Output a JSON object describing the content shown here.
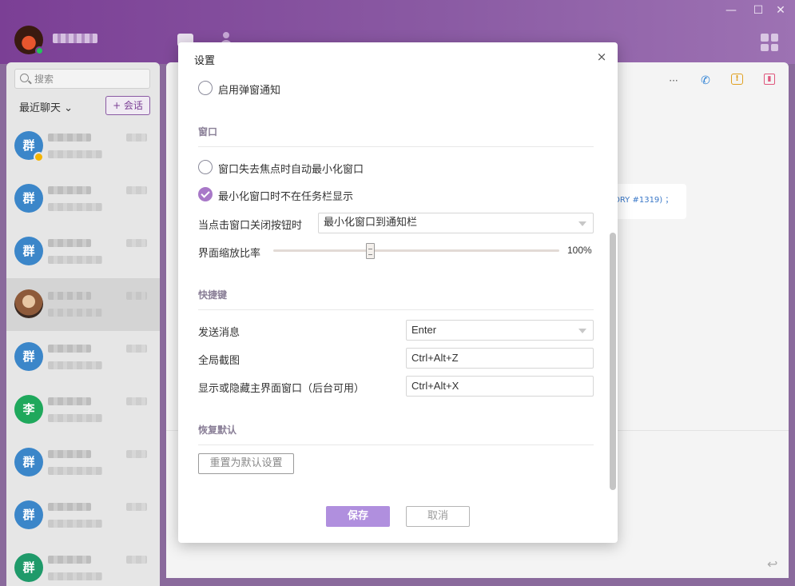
{
  "window": {
    "minimize": "—",
    "maximize": "☐",
    "close": "✕"
  },
  "sidebar": {
    "search_placeholder": "搜索",
    "recent_label": "最近聊天",
    "new_chat_label": "+ 会话",
    "conversations": [
      {
        "avatar_text": "群",
        "avatar_color": "#3b86c9"
      },
      {
        "avatar_text": "群",
        "avatar_color": "#3b86c9"
      },
      {
        "avatar_text": "群",
        "avatar_color": "#3b86c9"
      },
      {
        "avatar_text": "",
        "avatar_color": "#8e5a3a"
      },
      {
        "avatar_text": "群",
        "avatar_color": "#3b86c9"
      },
      {
        "avatar_text": "李",
        "avatar_color": "#1fa85c"
      },
      {
        "avatar_text": "群",
        "avatar_color": "#3b86c9"
      },
      {
        "avatar_text": "群",
        "avatar_color": "#3b86c9"
      },
      {
        "avatar_text": "群",
        "avatar_color": "#1f9a6a"
      }
    ]
  },
  "chat": {
    "message_fragment": "ORY #1319) ；",
    "actions": {
      "more": "···",
      "phone": "✆",
      "alert": "!",
      "panel": "▮"
    },
    "send_glyph": "↩"
  },
  "dialog": {
    "title": "设置",
    "close_glyph": "×",
    "popup_notify_label": "启用弹窗通知",
    "popup_notify_checked": false,
    "window_section": "窗口",
    "auto_minimize_label": "窗口失去焦点时自动最小化窗口",
    "auto_minimize_checked": false,
    "hide_taskbar_label": "最小化窗口时不在任务栏显示",
    "hide_taskbar_checked": true,
    "close_action_label": "当点击窗口关闭按钮时",
    "close_action_value": "最小化窗口到通知栏",
    "zoom_label": "界面缩放比率",
    "zoom_value": "100%",
    "shortcut_section": "快捷键",
    "send_msg_label": "发送消息",
    "send_msg_value": "Enter",
    "screenshot_label": "全局截图",
    "screenshot_value": "Ctrl+Alt+Z",
    "toggle_main_label": "显示或隐藏主界面窗口（后台可用）",
    "toggle_main_value": "Ctrl+Alt+X",
    "restore_section": "恢复默认",
    "reset_button": "重置为默认设置",
    "save_button": "保存",
    "cancel_button": "取消"
  },
  "colors": {
    "brand_purple": "#7b3f95",
    "accent_lavender": "#b08fde",
    "check_purple": "#a878c8"
  }
}
